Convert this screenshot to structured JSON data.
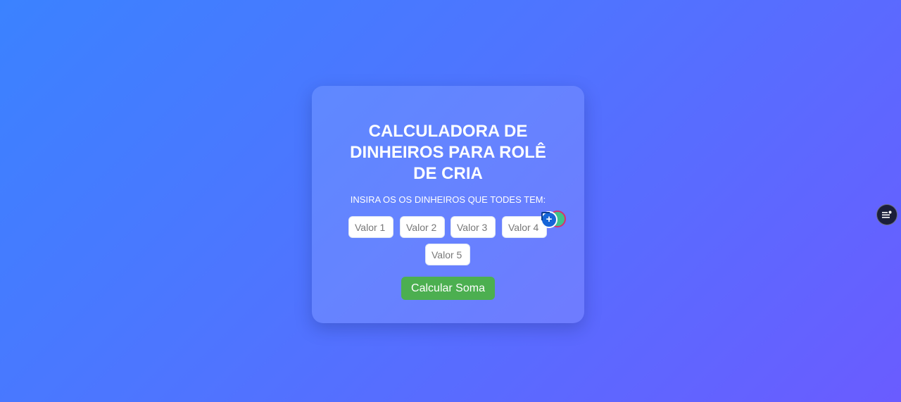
{
  "card": {
    "title": "CALCULADORA DE DINHEIROS PARA ROLÊ DE CRIA",
    "subtitle": "INSIRA OS OS DINHEIROS QUE TODES TEM:",
    "inputs": [
      {
        "placeholder": "Valor 1",
        "value": ""
      },
      {
        "placeholder": "Valor 2",
        "value": ""
      },
      {
        "placeholder": "Valor 3",
        "value": ""
      },
      {
        "placeholder": "Valor 4",
        "value": ""
      },
      {
        "placeholder": "Valor 5",
        "value": ""
      }
    ],
    "button_label": "Calcular Soma"
  },
  "extension_widget": {
    "icon": "plus-icon",
    "symbol": "+"
  },
  "side_fab": {
    "icon": "menu-list-icon"
  },
  "colors": {
    "background_start": "#3b82ff",
    "background_end": "#6a5cff",
    "button": "#4caf50",
    "text": "#ffffff"
  }
}
